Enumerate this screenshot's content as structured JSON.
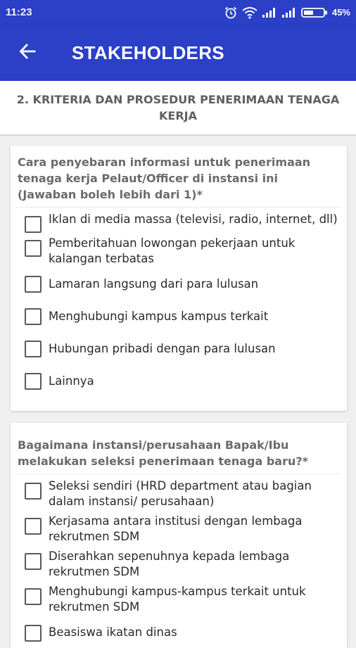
{
  "status_bar": {
    "time": "11:23",
    "battery_percent": "45%",
    "icons": [
      "alarm-icon",
      "wifi-icon",
      "signal-icon",
      "signal-icon",
      "battery-icon"
    ]
  },
  "app_bar": {
    "back_icon": "arrow-left-icon",
    "title": "STAKEHOLDERS",
    "color": "#2b3fc7"
  },
  "section": {
    "title": "2. KRITERIA DAN PROSEDUR PENERIMAAN TENAGA KERJA"
  },
  "questions": [
    {
      "text": "Cara penyebaran informasi untuk penerimaan tenaga kerja Pelaut/Officer di instansi ini (Jawaban boleh lebih dari 1)*",
      "options": [
        {
          "label": "Iklan di media massa (televisi, radio, internet, dll)",
          "checked": false
        },
        {
          "label": "Pemberitahuan lowongan pekerjaan untuk kalangan terbatas",
          "checked": false
        },
        {
          "label": "Lamaran langsung dari para lulusan",
          "checked": false
        },
        {
          "label": "Menghubungi kampus kampus terkait",
          "checked": false
        },
        {
          "label": "Hubungan pribadi dengan para lulusan",
          "checked": false
        },
        {
          "label": "Lainnya",
          "checked": false
        }
      ]
    },
    {
      "text": "Bagaimana instansi/perusahaan Bapak/Ibu melakukan seleksi penerimaan tenaga baru?*",
      "options": [
        {
          "label": "Seleksi sendiri (HRD department atau bagian dalam instansi/ perusahaan)",
          "checked": false
        },
        {
          "label": "Kerjasama antara institusi dengan lembaga rekrutmen SDM",
          "checked": false
        },
        {
          "label": "Diserahkan sepenuhnya kepada lembaga rekrutmen SDM",
          "checked": false
        },
        {
          "label": "Menghubungi kampus-kampus terkait untuk rekrutmen SDM",
          "checked": false
        },
        {
          "label": "Beasiswa ikatan dinas",
          "checked": false
        }
      ]
    }
  ]
}
